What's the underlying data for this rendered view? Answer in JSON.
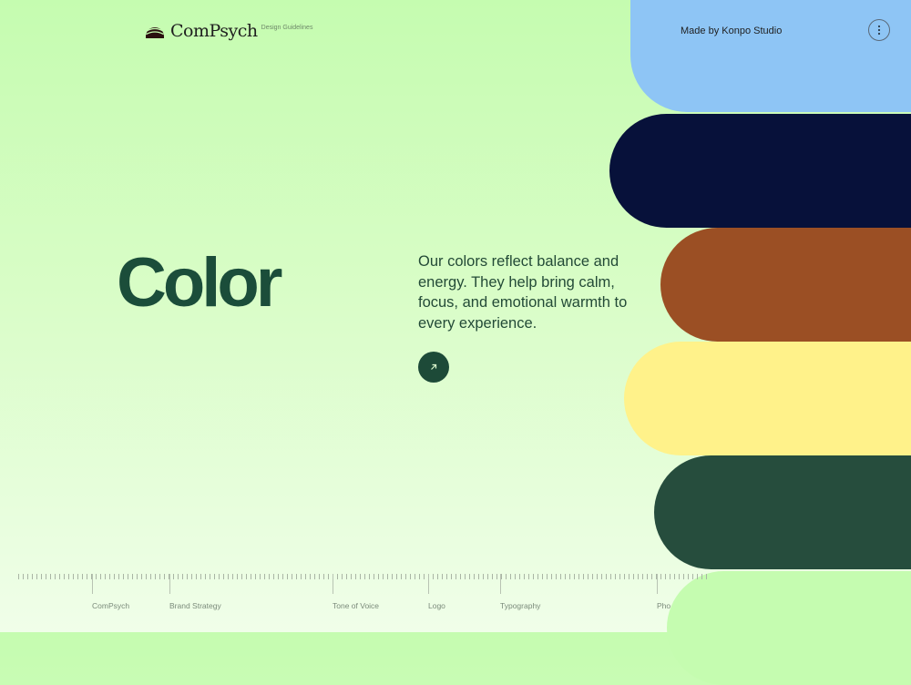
{
  "header": {
    "brand": "ComPsych",
    "brand_sub": "Design Guidelines",
    "made_by_prefix": "Made by",
    "made_by_studio": "Konpo Studio",
    "menu_icon": "more-vertical-icon"
  },
  "main": {
    "title": "Color",
    "description": "Our colors reflect balance and energy. They help bring calm, focus, and emotional warmth to every experience.",
    "cta_icon": "arrow-up-right-icon"
  },
  "swatches": [
    {
      "name": "sky-blue",
      "color": "#8ec5f5"
    },
    {
      "name": "navy",
      "color": "#07113a"
    },
    {
      "name": "rust",
      "color": "#9b4f24"
    },
    {
      "name": "butter-yellow",
      "color": "#fff28a"
    },
    {
      "name": "forest-green",
      "color": "#264d3d"
    },
    {
      "name": "mint-green",
      "color": "#c5fcb0"
    }
  ],
  "footer_nav": {
    "items": [
      "ComPsych",
      "Brand Strategy",
      "Tone of Voice",
      "Logo",
      "Typography",
      "Pho"
    ]
  },
  "colors": {
    "background": "#c5fcb0",
    "primary": "#1b4d3a"
  }
}
